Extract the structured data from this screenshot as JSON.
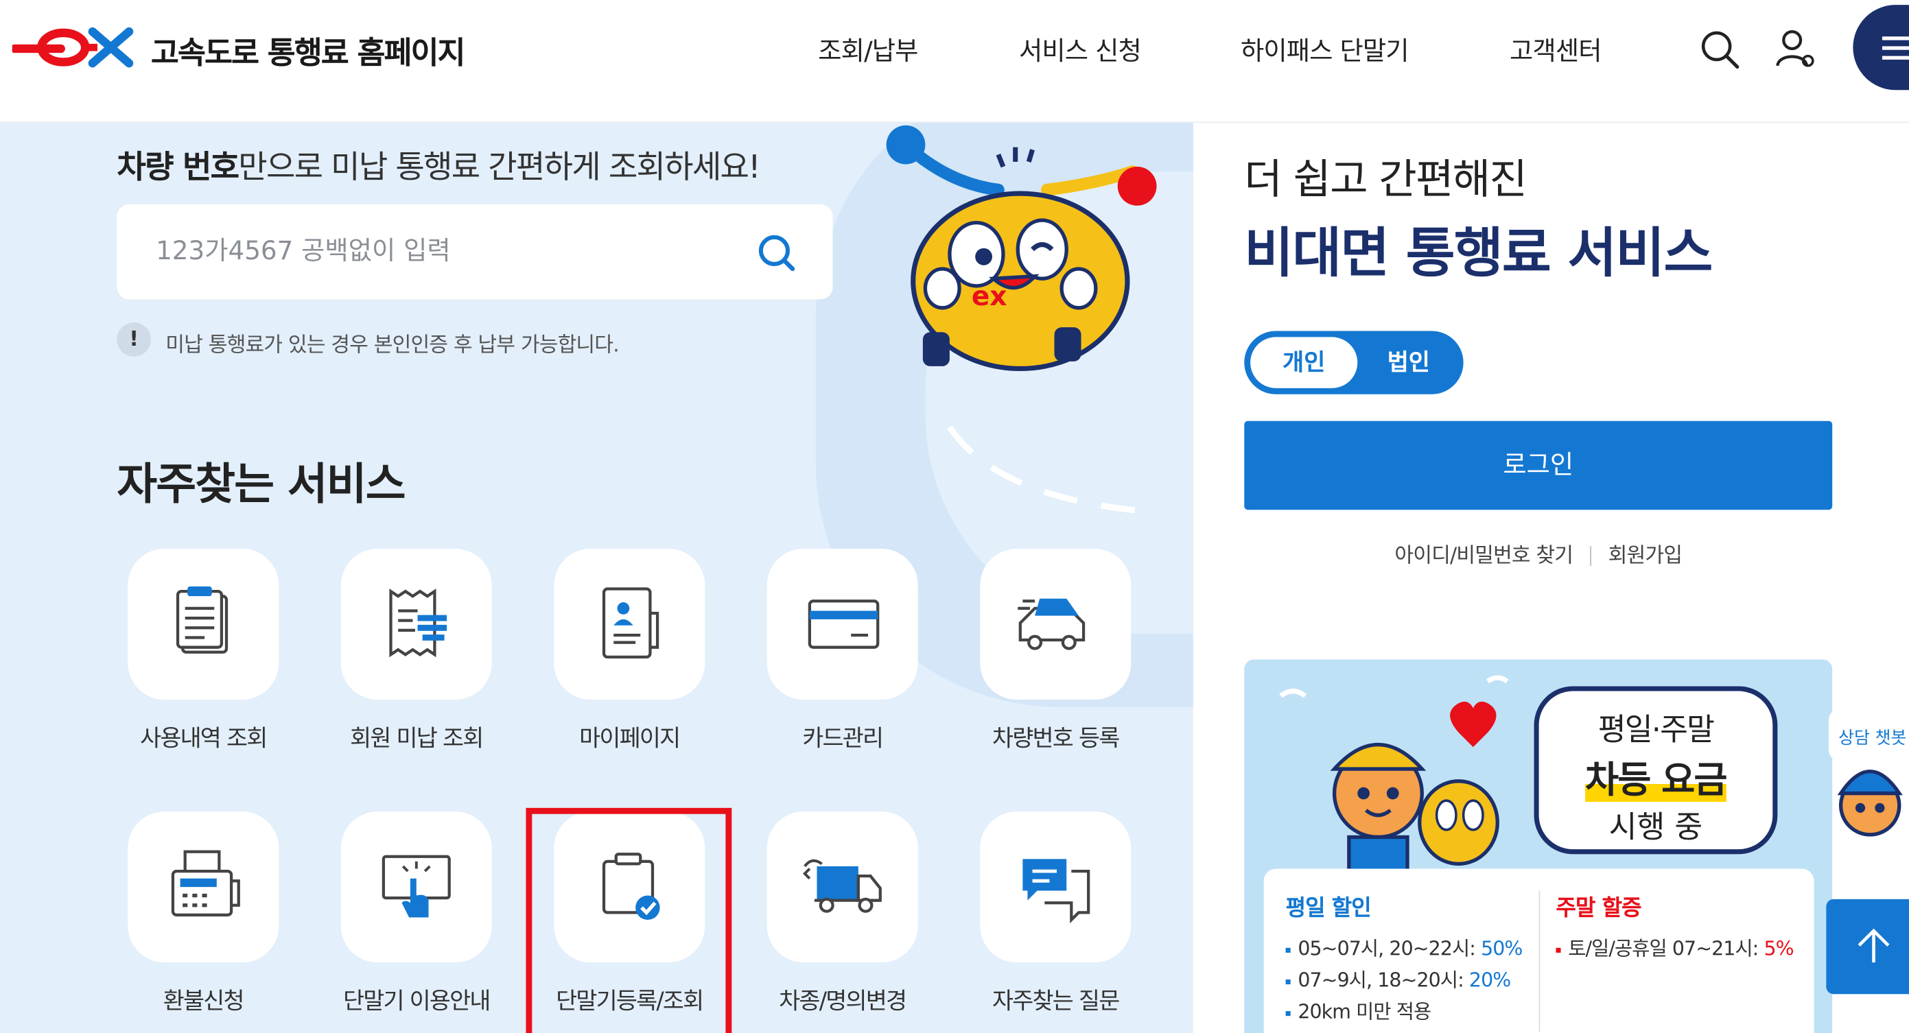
{
  "header": {
    "logo_text": "ex",
    "site_title": "고속도로 통행료 홈페이지",
    "nav": [
      "조회/납부",
      "서비스 신청",
      "하이패스 단말기",
      "고객센터"
    ],
    "icons": [
      "search-icon",
      "user-icon",
      "menu-icon"
    ]
  },
  "search": {
    "tagline_bold": "차량 번호",
    "tagline_rest": "만으로 미납 통행료 간편하게 조회하세요!",
    "placeholder": "123가4567 공백없이 입력",
    "notice": "미납 통행료가 있는 경우 본인인증 후 납부 가능합니다."
  },
  "services": {
    "title": "자주찾는 서비스",
    "items": [
      {
        "label": "사용내역 조회",
        "icon": "document-list-icon"
      },
      {
        "label": "회원 미납 조회",
        "icon": "receipt-icon"
      },
      {
        "label": "마이페이지",
        "icon": "profile-card-icon"
      },
      {
        "label": "카드관리",
        "icon": "credit-card-icon"
      },
      {
        "label": "차량번호 등록",
        "icon": "car-icon"
      },
      {
        "label": "환불신청",
        "icon": "fax-icon"
      },
      {
        "label": "단말기 이용안내",
        "icon": "touch-screen-icon"
      },
      {
        "label": "단말기등록/조회",
        "icon": "device-check-icon"
      },
      {
        "label": "차종/명의변경",
        "icon": "truck-swap-icon"
      },
      {
        "label": "자주찾는 질문",
        "icon": "chat-icon"
      }
    ],
    "highlighted": "단말기등록/조회"
  },
  "right": {
    "subtitle": "더 쉽고 간편해진",
    "title": "비대면 통행료 서비스",
    "toggle": {
      "on": "개인",
      "off": "법인"
    },
    "login": "로그인",
    "find_link": "아이디/비밀번호 찾기",
    "join_link": "회원가입"
  },
  "banner": {
    "bubble_line1": "평일·주말",
    "bubble_line2": "차등 요금",
    "bubble_line3": "시행 중",
    "weekday_title": "평일 할인",
    "weekday_items": [
      {
        "text": "05~07시, 20~22시: ",
        "value": "50%"
      },
      {
        "text": "07~9시, 18~20시: ",
        "value": "20%"
      },
      {
        "text": "20km 미만 적용",
        "value": ""
      }
    ],
    "weekend_title": "주말 할증",
    "weekend_items": [
      {
        "text": "토/일/공휴일 07~21시: ",
        "value": "5%"
      }
    ]
  },
  "side": {
    "chip": "상담 챗봇"
  },
  "colors": {
    "brand_red": "#e8101a",
    "brand_navy": "#1b2f6b",
    "primary_blue": "#1478d2",
    "panel_bg": "#e3effa"
  }
}
